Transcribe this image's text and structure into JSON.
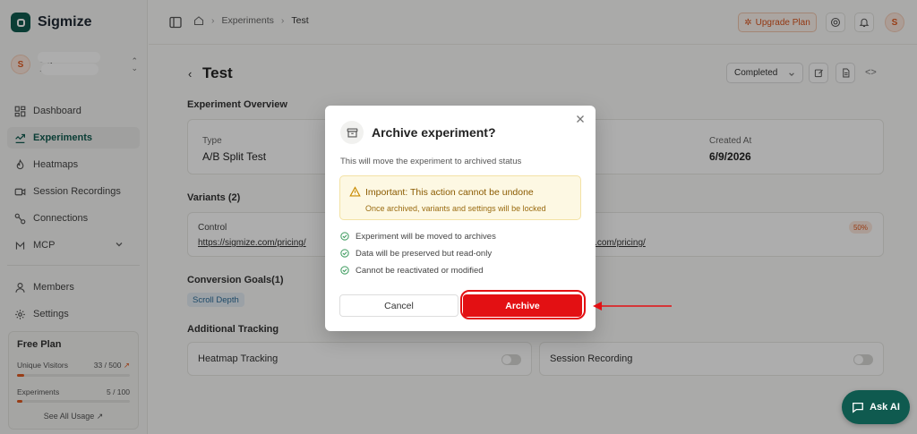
{
  "app": {
    "name": "Sigmize"
  },
  "account": {
    "avatar_letter": "S",
    "name": "Sigm... ...e ...",
    "email": "...or..."
  },
  "nav": {
    "items": [
      {
        "label": "Dashboard",
        "icon": "dashboard-icon"
      },
      {
        "label": "Experiments",
        "icon": "experiments-icon",
        "active": true
      },
      {
        "label": "Heatmaps",
        "icon": "heatmap-icon"
      },
      {
        "label": "Session Recordings",
        "icon": "video-icon"
      },
      {
        "label": "Connections",
        "icon": "connections-icon"
      },
      {
        "label": "MCP",
        "icon": "mcp-icon",
        "expandable": true
      }
    ],
    "secondary": [
      {
        "label": "Members",
        "icon": "members-icon"
      },
      {
        "label": "Settings",
        "icon": "gear-icon"
      }
    ]
  },
  "plan": {
    "title": "Free Plan",
    "visitors_label": "Unique Visitors",
    "visitors_value": "33 / 500",
    "visitors_fraction": 0.066,
    "experiments_label": "Experiments",
    "experiments_value": "5 / 100",
    "experiments_fraction": 0.05,
    "see_all": "See All Usage ↗"
  },
  "topbar": {
    "breadcrumbs": [
      "Experiments",
      "Test"
    ],
    "upgrade_label": "Upgrade Plan",
    "user_letter": "S"
  },
  "page": {
    "title": "Test",
    "status": "Completed",
    "overview_title": "Experiment Overview",
    "type_label": "Type",
    "type_value": "A/B Split Test",
    "created_label": "Created At",
    "created_value": "6/9/2026",
    "variants_title": "Variants (2)",
    "control_label": "Control",
    "control_url": "https://sigmize.com/pricing/",
    "variant_url_partial": "...ize.com/pricing/",
    "variant_pct": "50%",
    "goals_title": "Conversion Goals(1)",
    "goal_chip": "Scroll Depth",
    "tracking_title": "Additional Tracking",
    "heatmap_label": "Heatmap Tracking",
    "recording_label": "Session Recording"
  },
  "ask_ai": "Ask AI",
  "modal": {
    "title": "Archive experiment?",
    "description": "This will move the experiment to archived status",
    "warning_title": "Important: This action cannot be undone",
    "warning_sub": "Once archived, variants and settings will be locked",
    "checks": [
      "Experiment will be moved to archives",
      "Data will be preserved but read-only",
      "Cannot be reactivated or modified"
    ],
    "cancel_label": "Cancel",
    "archive_label": "Archive"
  },
  "colors": {
    "brand": "#0f5a4f",
    "accent": "#e15a21",
    "danger": "#e31013"
  }
}
